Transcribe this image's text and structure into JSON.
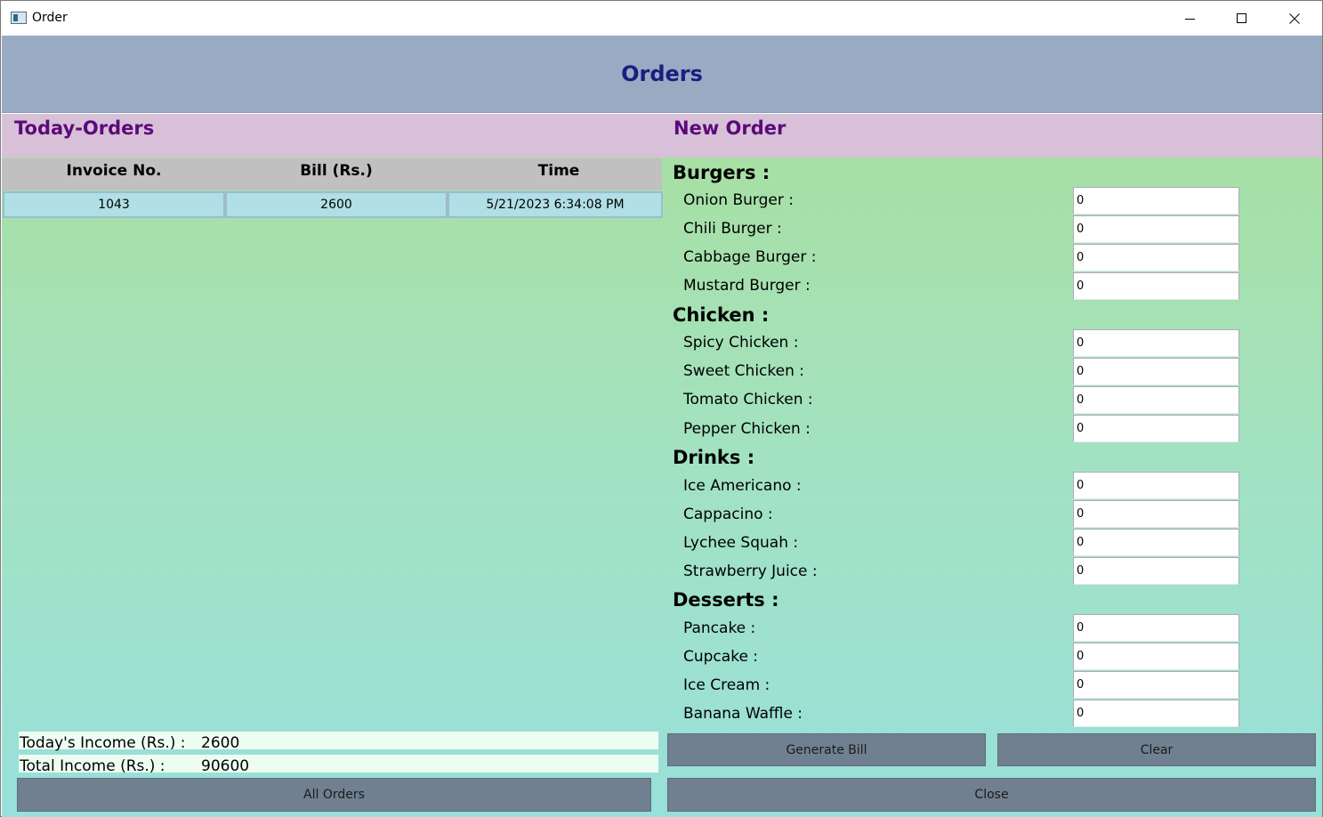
{
  "window": {
    "title": "Order",
    "controls": [
      "minimize",
      "maximize",
      "close"
    ]
  },
  "header": {
    "title": "Orders"
  },
  "left": {
    "section_title": "Today-Orders",
    "table": {
      "columns": [
        "Invoice No.",
        "Bill (Rs.)",
        "Time"
      ],
      "rows": [
        [
          "1043",
          "2600",
          "5/21/2023 6:34:08 PM"
        ]
      ]
    },
    "income": {
      "today_label": "Today's Income (Rs.) :",
      "today_value": "2600",
      "total_label": "Total Income (Rs.) :",
      "total_value": "90600"
    },
    "all_orders_label": "All Orders"
  },
  "right": {
    "section_title": "New Order",
    "categories": [
      {
        "title": "Burgers :",
        "items": [
          {
            "label": "Onion Burger :",
            "qty": "0"
          },
          {
            "label": "Chili Burger :",
            "qty": "0"
          },
          {
            "label": "Cabbage Burger :",
            "qty": "0"
          },
          {
            "label": "Mustard Burger :",
            "qty": "0"
          }
        ]
      },
      {
        "title": "Chicken :",
        "items": [
          {
            "label": "Spicy Chicken :",
            "qty": "0"
          },
          {
            "label": "Sweet Chicken :",
            "qty": "0"
          },
          {
            "label": "Tomato Chicken :",
            "qty": "0"
          },
          {
            "label": "Pepper Chicken :",
            "qty": "0"
          }
        ]
      },
      {
        "title": "Drinks :",
        "items": [
          {
            "label": "Ice Americano :",
            "qty": "0"
          },
          {
            "label": "Cappacino :",
            "qty": "0"
          },
          {
            "label": "Lychee Squah :",
            "qty": "0"
          },
          {
            "label": "Strawberry Juice :",
            "qty": "0"
          }
        ]
      },
      {
        "title": "Desserts :",
        "items": [
          {
            "label": "Pancake :",
            "qty": "0"
          },
          {
            "label": "Cupcake :",
            "qty": "0"
          },
          {
            "label": "Ice Cream :",
            "qty": "0"
          },
          {
            "label": "Banana Waffle :",
            "qty": "0"
          }
        ]
      }
    ],
    "generate_bill_label": "Generate Bill",
    "clear_label": "Clear",
    "close_label": "Close"
  },
  "colors": {
    "header_bg": "#98abc2",
    "header_text": "#1a1e82",
    "section_bg": "#d8c0d8",
    "section_text": "#5a0a7a",
    "gradient_top": "#a7e0a4",
    "gradient_bottom": "#98e0da",
    "button_bg": "#708090",
    "grid_cell_bg": "#b0dfe6",
    "grid_header_bg": "#c0c0c0"
  }
}
